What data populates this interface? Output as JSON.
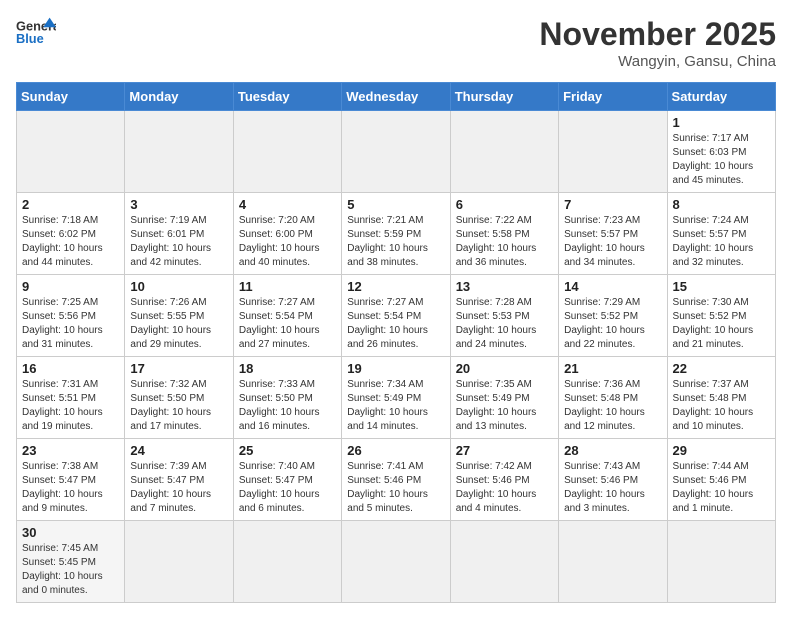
{
  "header": {
    "logo_general": "General",
    "logo_blue": "Blue",
    "month_title": "November 2025",
    "location": "Wangyin, Gansu, China"
  },
  "weekdays": [
    "Sunday",
    "Monday",
    "Tuesday",
    "Wednesday",
    "Thursday",
    "Friday",
    "Saturday"
  ],
  "weeks": [
    [
      {
        "day": "",
        "info": ""
      },
      {
        "day": "",
        "info": ""
      },
      {
        "day": "",
        "info": ""
      },
      {
        "day": "",
        "info": ""
      },
      {
        "day": "",
        "info": ""
      },
      {
        "day": "",
        "info": ""
      },
      {
        "day": "1",
        "info": "Sunrise: 7:17 AM\nSunset: 6:03 PM\nDaylight: 10 hours and 45 minutes."
      }
    ],
    [
      {
        "day": "2",
        "info": "Sunrise: 7:18 AM\nSunset: 6:02 PM\nDaylight: 10 hours and 44 minutes."
      },
      {
        "day": "3",
        "info": "Sunrise: 7:19 AM\nSunset: 6:01 PM\nDaylight: 10 hours and 42 minutes."
      },
      {
        "day": "4",
        "info": "Sunrise: 7:20 AM\nSunset: 6:00 PM\nDaylight: 10 hours and 40 minutes."
      },
      {
        "day": "5",
        "info": "Sunrise: 7:21 AM\nSunset: 5:59 PM\nDaylight: 10 hours and 38 minutes."
      },
      {
        "day": "6",
        "info": "Sunrise: 7:22 AM\nSunset: 5:58 PM\nDaylight: 10 hours and 36 minutes."
      },
      {
        "day": "7",
        "info": "Sunrise: 7:23 AM\nSunset: 5:57 PM\nDaylight: 10 hours and 34 minutes."
      },
      {
        "day": "8",
        "info": "Sunrise: 7:24 AM\nSunset: 5:57 PM\nDaylight: 10 hours and 32 minutes."
      }
    ],
    [
      {
        "day": "9",
        "info": "Sunrise: 7:25 AM\nSunset: 5:56 PM\nDaylight: 10 hours and 31 minutes."
      },
      {
        "day": "10",
        "info": "Sunrise: 7:26 AM\nSunset: 5:55 PM\nDaylight: 10 hours and 29 minutes."
      },
      {
        "day": "11",
        "info": "Sunrise: 7:27 AM\nSunset: 5:54 PM\nDaylight: 10 hours and 27 minutes."
      },
      {
        "day": "12",
        "info": "Sunrise: 7:27 AM\nSunset: 5:54 PM\nDaylight: 10 hours and 26 minutes."
      },
      {
        "day": "13",
        "info": "Sunrise: 7:28 AM\nSunset: 5:53 PM\nDaylight: 10 hours and 24 minutes."
      },
      {
        "day": "14",
        "info": "Sunrise: 7:29 AM\nSunset: 5:52 PM\nDaylight: 10 hours and 22 minutes."
      },
      {
        "day": "15",
        "info": "Sunrise: 7:30 AM\nSunset: 5:52 PM\nDaylight: 10 hours and 21 minutes."
      }
    ],
    [
      {
        "day": "16",
        "info": "Sunrise: 7:31 AM\nSunset: 5:51 PM\nDaylight: 10 hours and 19 minutes."
      },
      {
        "day": "17",
        "info": "Sunrise: 7:32 AM\nSunset: 5:50 PM\nDaylight: 10 hours and 17 minutes."
      },
      {
        "day": "18",
        "info": "Sunrise: 7:33 AM\nSunset: 5:50 PM\nDaylight: 10 hours and 16 minutes."
      },
      {
        "day": "19",
        "info": "Sunrise: 7:34 AM\nSunset: 5:49 PM\nDaylight: 10 hours and 14 minutes."
      },
      {
        "day": "20",
        "info": "Sunrise: 7:35 AM\nSunset: 5:49 PM\nDaylight: 10 hours and 13 minutes."
      },
      {
        "day": "21",
        "info": "Sunrise: 7:36 AM\nSunset: 5:48 PM\nDaylight: 10 hours and 12 minutes."
      },
      {
        "day": "22",
        "info": "Sunrise: 7:37 AM\nSunset: 5:48 PM\nDaylight: 10 hours and 10 minutes."
      }
    ],
    [
      {
        "day": "23",
        "info": "Sunrise: 7:38 AM\nSunset: 5:47 PM\nDaylight: 10 hours and 9 minutes."
      },
      {
        "day": "24",
        "info": "Sunrise: 7:39 AM\nSunset: 5:47 PM\nDaylight: 10 hours and 7 minutes."
      },
      {
        "day": "25",
        "info": "Sunrise: 7:40 AM\nSunset: 5:47 PM\nDaylight: 10 hours and 6 minutes."
      },
      {
        "day": "26",
        "info": "Sunrise: 7:41 AM\nSunset: 5:46 PM\nDaylight: 10 hours and 5 minutes."
      },
      {
        "day": "27",
        "info": "Sunrise: 7:42 AM\nSunset: 5:46 PM\nDaylight: 10 hours and 4 minutes."
      },
      {
        "day": "28",
        "info": "Sunrise: 7:43 AM\nSunset: 5:46 PM\nDaylight: 10 hours and 3 minutes."
      },
      {
        "day": "29",
        "info": "Sunrise: 7:44 AM\nSunset: 5:46 PM\nDaylight: 10 hours and 1 minute."
      }
    ],
    [
      {
        "day": "30",
        "info": "Sunrise: 7:45 AM\nSunset: 5:45 PM\nDaylight: 10 hours and 0 minutes."
      },
      {
        "day": "",
        "info": ""
      },
      {
        "day": "",
        "info": ""
      },
      {
        "day": "",
        "info": ""
      },
      {
        "day": "",
        "info": ""
      },
      {
        "day": "",
        "info": ""
      },
      {
        "day": "",
        "info": ""
      }
    ]
  ]
}
